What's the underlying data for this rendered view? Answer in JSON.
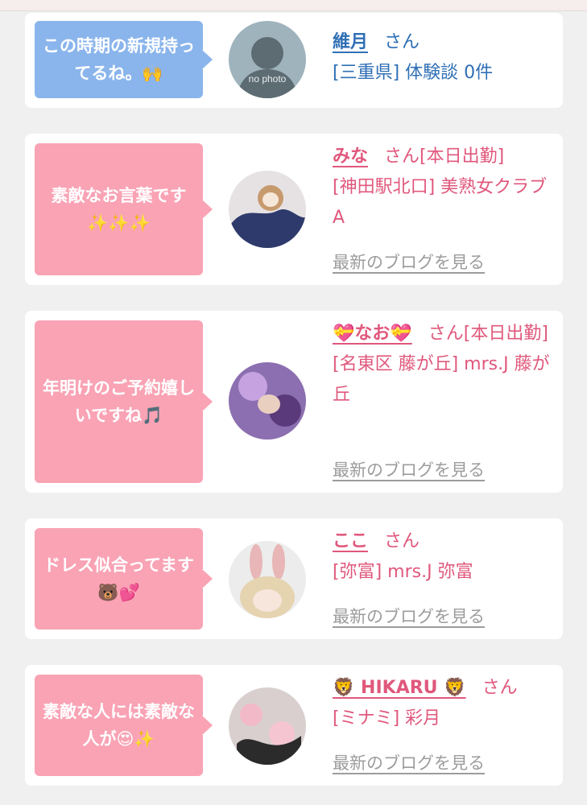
{
  "reviews": [
    {
      "comment": "この時期の新規持ってるね。🙌",
      "name": "維月",
      "suffix": "さん",
      "detail": "[三重県] 体験談 0件",
      "photo_label": "no photo"
    },
    {
      "comment": "素敵なお言葉です✨✨✨",
      "name": "みな",
      "suffix": "さん[本日出勤]",
      "detail": "[神田駅北口] 美熟女クラブA",
      "blog_link": "最新のブログを見る"
    },
    {
      "comment": "年明けのご予約嬉しいですね🎵",
      "name": "💝なお💝",
      "suffix": "さん[本日出勤]",
      "detail": "[名東区 藤が丘] mrs.J 藤が丘",
      "blog_link": "最新のブログを見る"
    },
    {
      "comment": "ドレス似合ってます🐻💕",
      "name": "ここ",
      "suffix": "さん",
      "detail": "[弥富] mrs.J 弥富",
      "blog_link": "最新のブログを見る"
    },
    {
      "comment": "素敵な人には素敵な人が😍✨",
      "name": "🦁 HIKARU 🦁",
      "suffix": "さん",
      "detail": "[ミナミ] 彩月",
      "blog_link": "最新のブログを見る"
    }
  ],
  "colors": {
    "blue_bubble": "#8ab5ec",
    "pink_bubble": "#f9a3b5",
    "blue_text": "#2f6fb5",
    "pink_text": "#e0587c"
  }
}
